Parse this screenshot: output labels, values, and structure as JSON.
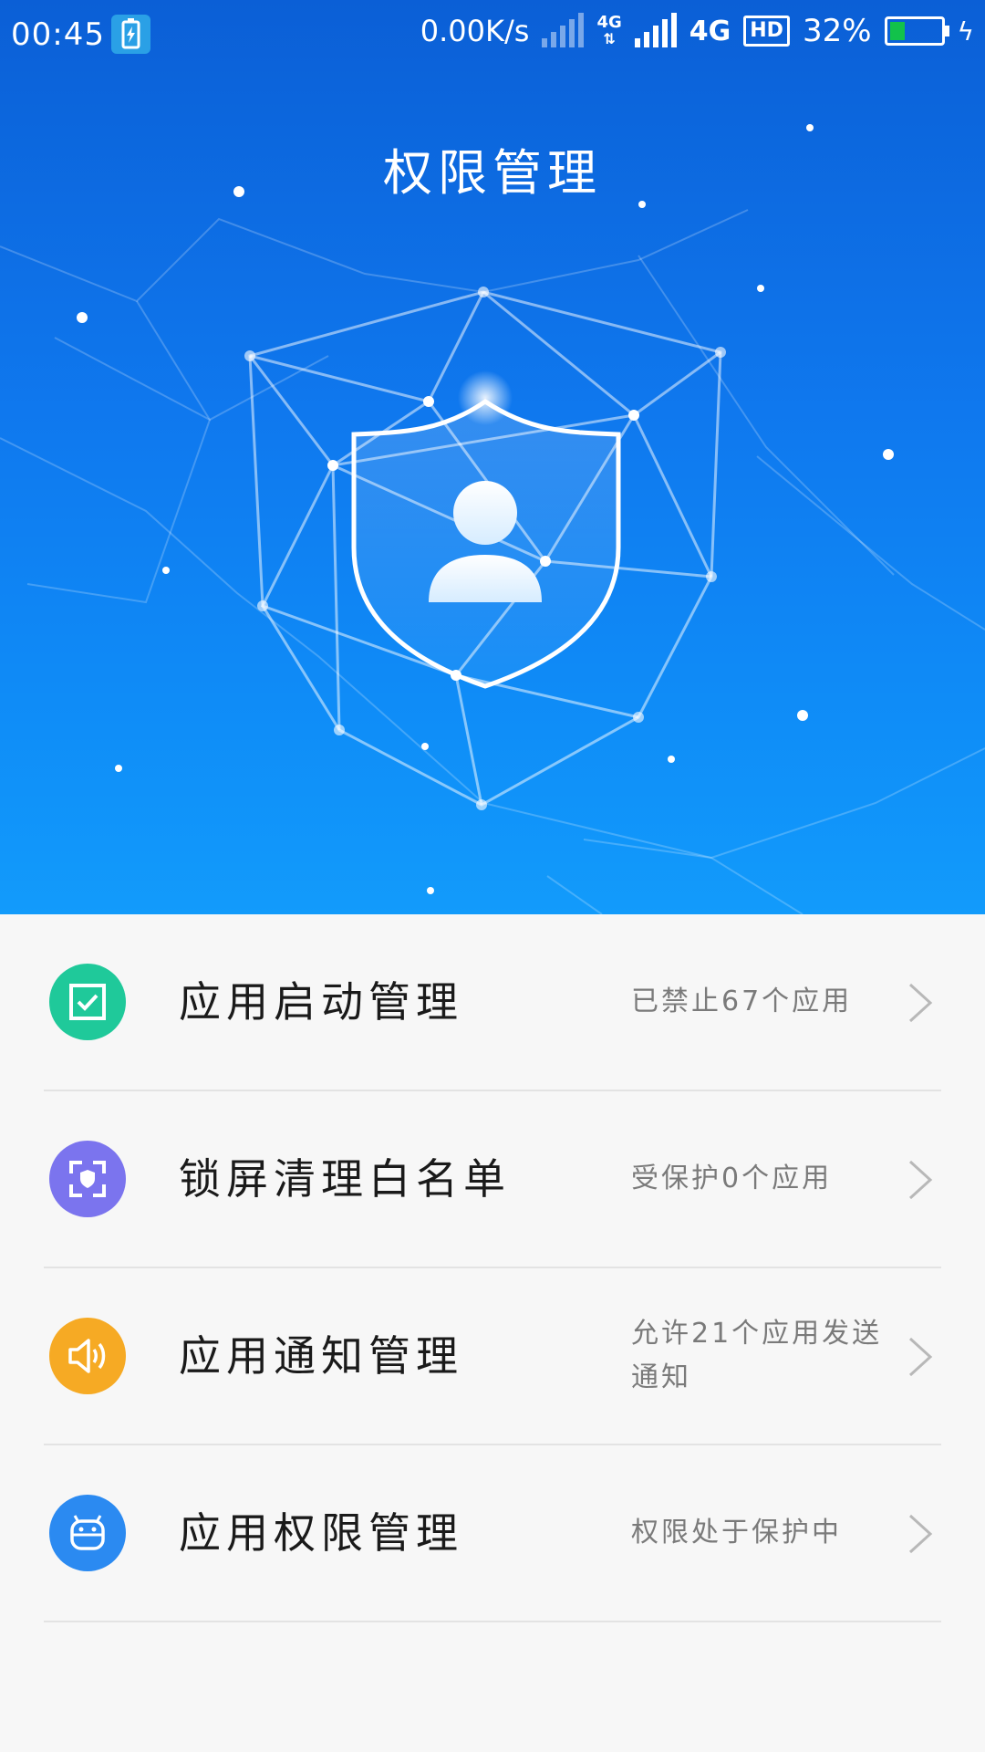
{
  "status_bar": {
    "time": "00:45",
    "network_speed": "0.00K/s",
    "network_type_small": "4G",
    "network_type": "4G",
    "hd_label": "HD",
    "battery_percent": "32%",
    "battery_level": 0.32,
    "battery_color": "#12c24a"
  },
  "header": {
    "title": "权限管理"
  },
  "items": [
    {
      "label": "应用启动管理",
      "status": "已禁止67个应用",
      "icon": "checkbox-icon",
      "color": "#1fc99a"
    },
    {
      "label": "锁屏清理白名单",
      "status": "受保护0个应用",
      "icon": "lock-shield-icon",
      "color": "#7b74ee"
    },
    {
      "label": "应用通知管理",
      "status": "允许21个应用发送通知",
      "icon": "speaker-icon",
      "color": "#f6aa24"
    },
    {
      "label": "应用权限管理",
      "status": "权限处于保护中",
      "icon": "android-icon",
      "color": "#2b8af1"
    }
  ],
  "colors": {
    "header_top": "#0b5fd6",
    "header_bottom": "#129bfb",
    "background": "#f7f7f7"
  }
}
